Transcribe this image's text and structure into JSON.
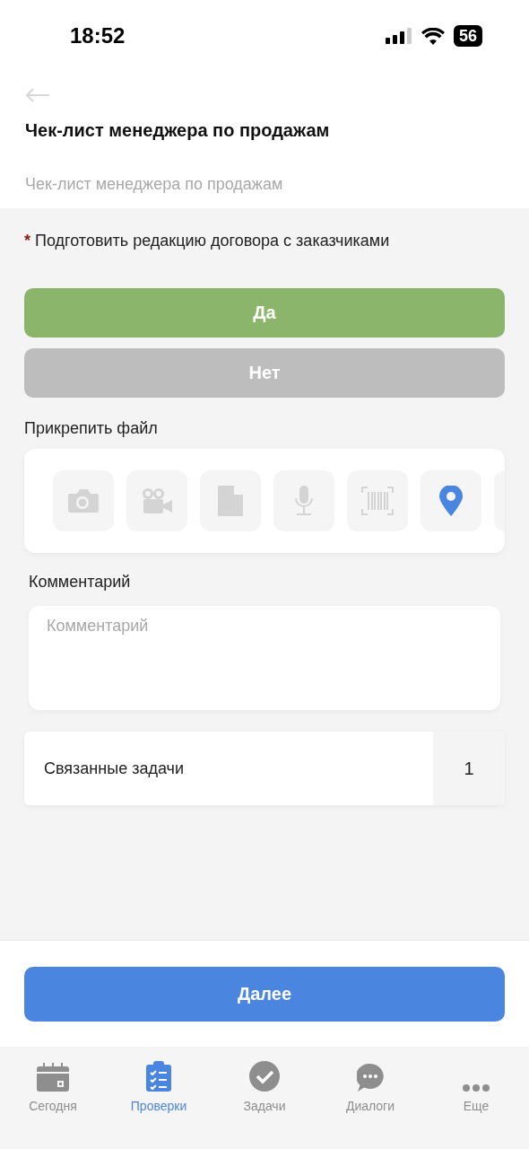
{
  "status_bar": {
    "time": "18:52",
    "battery": "56"
  },
  "header": {
    "title": "Чек-лист менеджера по продажам",
    "subtitle": "Чек-лист менеджера по продажам"
  },
  "question": {
    "required": true,
    "mark": "*",
    "text": "Подготовить редакцию договора с заказчиками"
  },
  "answers": [
    {
      "label": "Да",
      "kind": "yes",
      "selected": true
    },
    {
      "label": "Нет",
      "kind": "no",
      "selected": false
    }
  ],
  "attach": {
    "label": "Прикрепить файл",
    "items": [
      {
        "kind": "camera",
        "enabled": false
      },
      {
        "kind": "video",
        "enabled": false
      },
      {
        "kind": "document",
        "enabled": false
      },
      {
        "kind": "microphone",
        "enabled": false
      },
      {
        "kind": "barcode",
        "enabled": false
      },
      {
        "kind": "location",
        "enabled": true
      },
      {
        "kind": "partial"
      }
    ]
  },
  "comment": {
    "label": "Комментарий",
    "placeholder": "Комментарий"
  },
  "related": {
    "label": "Связанные задачи",
    "count": "1"
  },
  "next_button": "Далее",
  "tabs": [
    {
      "label": "Сегодня",
      "kind": "calendar",
      "selected": false
    },
    {
      "label": "Проверки",
      "kind": "checklist",
      "selected": true
    },
    {
      "label": "Задачи",
      "kind": "check",
      "selected": false
    },
    {
      "label": "Диалоги",
      "kind": "chat",
      "selected": false
    },
    {
      "label": "Еще",
      "kind": "more",
      "selected": false
    }
  ]
}
